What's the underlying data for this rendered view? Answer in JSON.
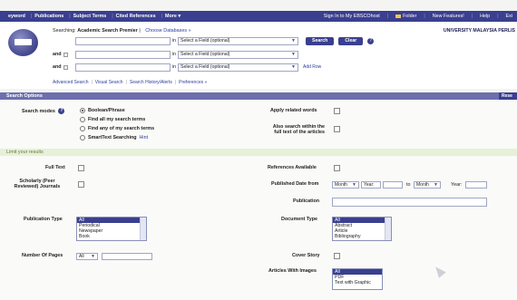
{
  "topbar": {
    "left_items": [
      "eyword",
      "Publications",
      "Subject Terms",
      "Cited References",
      "More"
    ],
    "more_caret": "▾",
    "right_items": [
      "Sign In to My EBSCOhost",
      "Folder",
      "New Features!",
      "Help",
      "Exi"
    ]
  },
  "header": {
    "searching_label": "Searching:",
    "database": "Academic Search Premier",
    "choose_databases": "Choose Databases »",
    "institution": "UNIVERSITY MALAYSIA PERLIS",
    "rows": [
      {
        "operator": "",
        "in_label": "in",
        "field": "Select a Field (optional)"
      },
      {
        "operator": "and",
        "in_label": "in",
        "field": "Select a Field (optional)"
      },
      {
        "operator": "and",
        "in_label": "in",
        "field": "Select a Field (optional)"
      }
    ],
    "search_button": "Search",
    "clear_button": "Clear",
    "help_glyph": "?",
    "add_row": "Add Row",
    "links": [
      "Advanced Search",
      "Visual Search",
      "Search History/Alerts",
      "Preferences »"
    ]
  },
  "search_options": {
    "header": "Search Options",
    "reset": "Rese",
    "search_modes_label": "Search modes",
    "modes": [
      "Boolean/Phrase",
      "Find all my search terms",
      "Find any of my search terms",
      "SmartText Searching"
    ],
    "hint_label": "Hint",
    "apply_related_label": "Apply related words",
    "also_search_label_1": "Also search within the",
    "also_search_label_2": "full text of the articles"
  },
  "limits": {
    "header": "Limit your results",
    "full_text": "Full Text",
    "scholarly_1": "Scholarly (Peer",
    "scholarly_2": "Reviewed) Journals",
    "references_available": "References Available",
    "published_date_label": "Published Date from",
    "month_label": "Month",
    "year_label": "Year:",
    "to_label": "to",
    "publication_label": "Publication",
    "publication_type_label": "Publication Type",
    "publication_types": [
      "All",
      "Periodical",
      "Newspaper",
      "Book"
    ],
    "document_type_label": "Document Type",
    "document_types": [
      "All",
      "Abstract",
      "Article",
      "Bibliography"
    ],
    "number_of_pages_label": "Number Of Pages",
    "pages_value": "All",
    "cover_story_label": "Cover Story",
    "articles_with_images_label": "Articles With Images",
    "image_types": [
      "All",
      "PDF",
      "Text with Graphic"
    ]
  }
}
